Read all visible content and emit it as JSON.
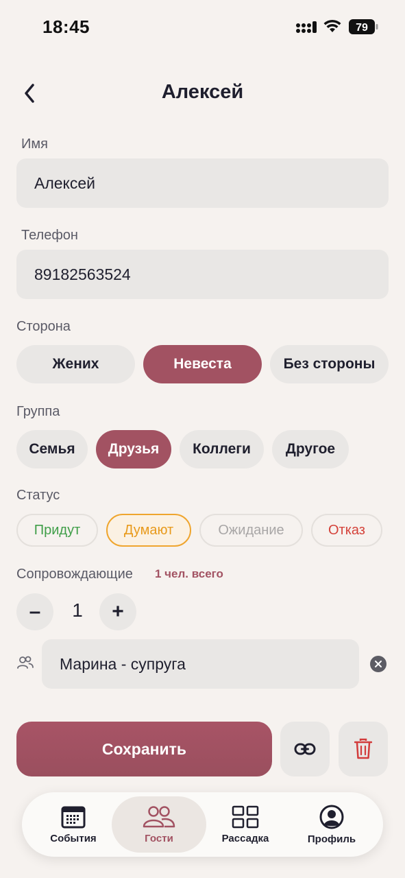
{
  "status_bar": {
    "time": "18:45",
    "battery": "79"
  },
  "header": {
    "title": "Алексей"
  },
  "form": {
    "name": {
      "label": "Имя",
      "value": "Алексей"
    },
    "phone": {
      "label": "Телефон",
      "value": "89182563524"
    },
    "side": {
      "label": "Сторона",
      "options": [
        "Жених",
        "Невеста",
        "Без стороны"
      ],
      "selected": "Невеста"
    },
    "group": {
      "label": "Группа",
      "options": [
        "Семья",
        "Друзья",
        "Коллеги",
        "Другое"
      ],
      "selected": "Друзья"
    },
    "status": {
      "label": "Статус",
      "options": [
        "Придут",
        "Думают",
        "Ожидание",
        "Отказ"
      ],
      "selected": "Думают",
      "colors": {
        "Придут": "#3f9e48",
        "Думают": "#e89a1c",
        "Ожидание": "#a8a6a6",
        "Отказ": "#d4423a"
      }
    },
    "companions": {
      "label": "Сопровождающие",
      "total_text": "1 чел. всего",
      "minus": "–",
      "plus": "+",
      "count": "1",
      "items": [
        {
          "value": "Марина - супруга"
        }
      ]
    }
  },
  "actions": {
    "save_label": "Сохранить",
    "link_icon": "link-icon",
    "delete_icon": "trash-icon"
  },
  "tab_bar": {
    "items": [
      {
        "label": "События",
        "icon": "calendar-icon"
      },
      {
        "label": "Гости",
        "icon": "guests-icon",
        "active": true
      },
      {
        "label": "Рассадка",
        "icon": "grid-icon"
      },
      {
        "label": "Профиль",
        "icon": "profile-icon"
      }
    ]
  },
  "colors": {
    "accent": "#a25262",
    "background": "#f6f2ef",
    "field": "#e9e7e5"
  }
}
